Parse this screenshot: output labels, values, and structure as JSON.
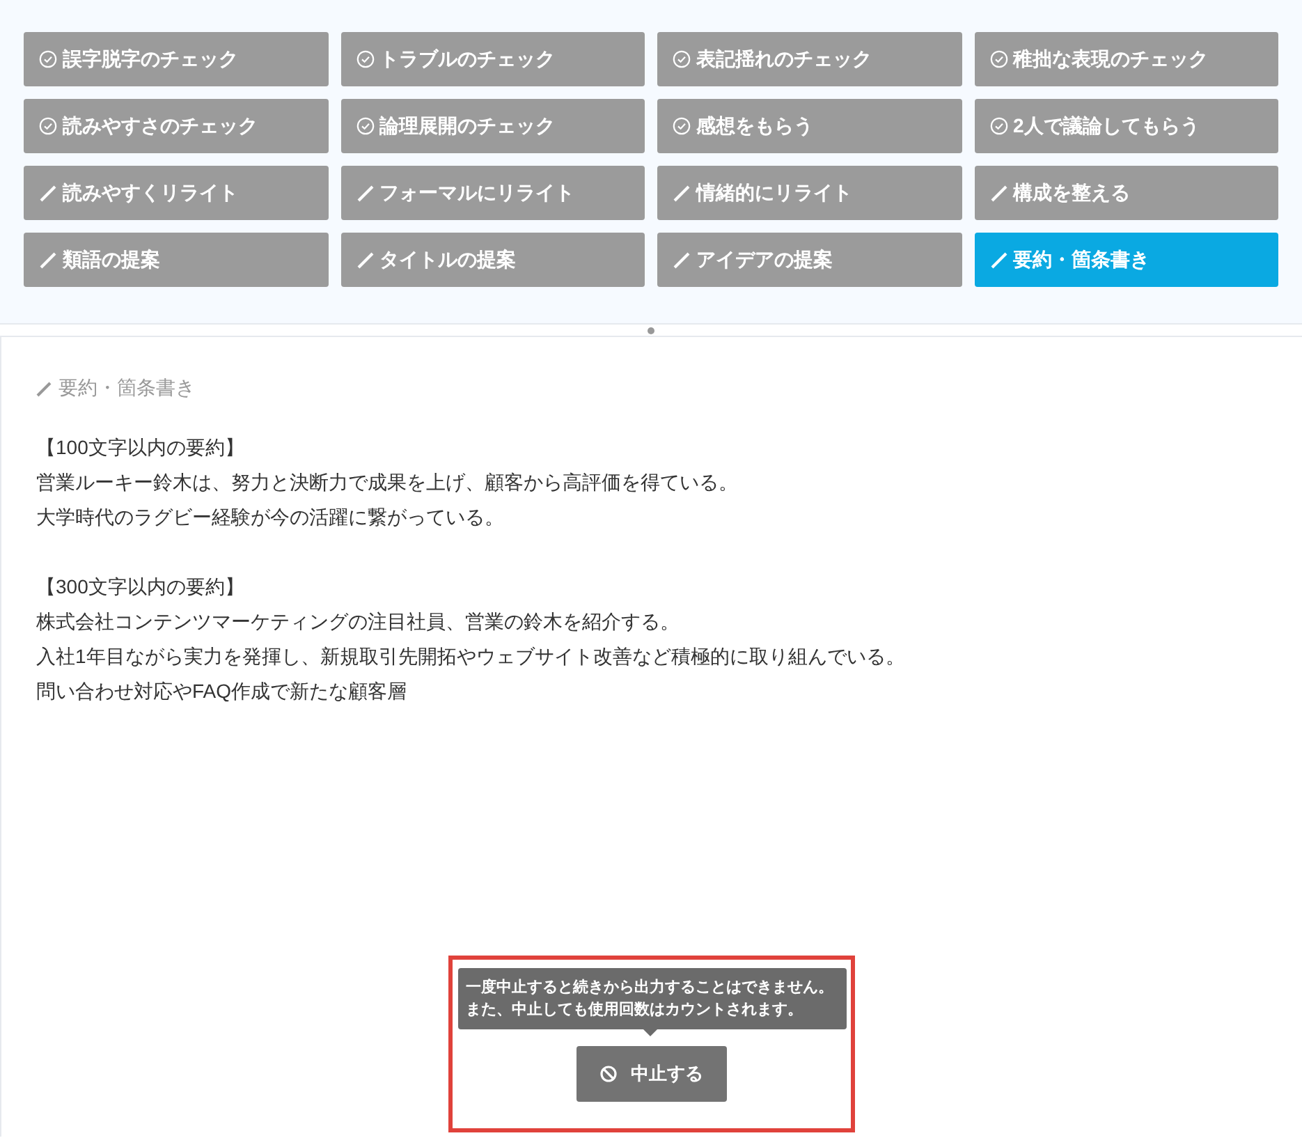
{
  "actions": [
    {
      "label": "誤字脱字のチェック",
      "kind": "check",
      "selected": false
    },
    {
      "label": "トラブルのチェック",
      "kind": "check",
      "selected": false
    },
    {
      "label": "表記揺れのチェック",
      "kind": "check",
      "selected": false
    },
    {
      "label": "稚拙な表現のチェック",
      "kind": "check",
      "selected": false
    },
    {
      "label": "読みやすさのチェック",
      "kind": "check",
      "selected": false
    },
    {
      "label": "論理展開のチェック",
      "kind": "check",
      "selected": false
    },
    {
      "label": "感想をもらう",
      "kind": "check",
      "selected": false
    },
    {
      "label": "2人で議論してもらう",
      "kind": "check",
      "selected": false
    },
    {
      "label": "読みやすくリライト",
      "kind": "rewrite",
      "selected": false
    },
    {
      "label": "フォーマルにリライト",
      "kind": "rewrite",
      "selected": false
    },
    {
      "label": "情緒的にリライト",
      "kind": "rewrite",
      "selected": false
    },
    {
      "label": "構成を整える",
      "kind": "rewrite",
      "selected": false
    },
    {
      "label": "類語の提案",
      "kind": "rewrite",
      "selected": false
    },
    {
      "label": "タイトルの提案",
      "kind": "rewrite",
      "selected": false
    },
    {
      "label": "アイデアの提案",
      "kind": "rewrite",
      "selected": false
    },
    {
      "label": "要約・箇条書き",
      "kind": "rewrite",
      "selected": true
    }
  ],
  "result": {
    "heading": "要約・箇条書き",
    "paragraphs": [
      [
        "【100文字以内の要約】",
        "営業ルーキー鈴木は、努力と決断力で成果を上げ、顧客から高評価を得ている。",
        "大学時代のラグビー経験が今の活躍に繋がっている。"
      ],
      [
        "【300文字以内の要約】",
        "株式会社コンテンツマーケティングの注目社員、営業の鈴木を紹介する。",
        "入社1年目ながら実力を発揮し、新規取引先開拓やウェブサイト改善など積極的に取り組んでいる。",
        "問い合わせ対応やFAQ作成で新たな顧客層"
      ]
    ]
  },
  "tooltip": [
    "一度中止すると続きから出力することはできません。",
    "また、中止しても使用回数はカウントされます。"
  ],
  "stop_button": {
    "label": "中止する"
  }
}
